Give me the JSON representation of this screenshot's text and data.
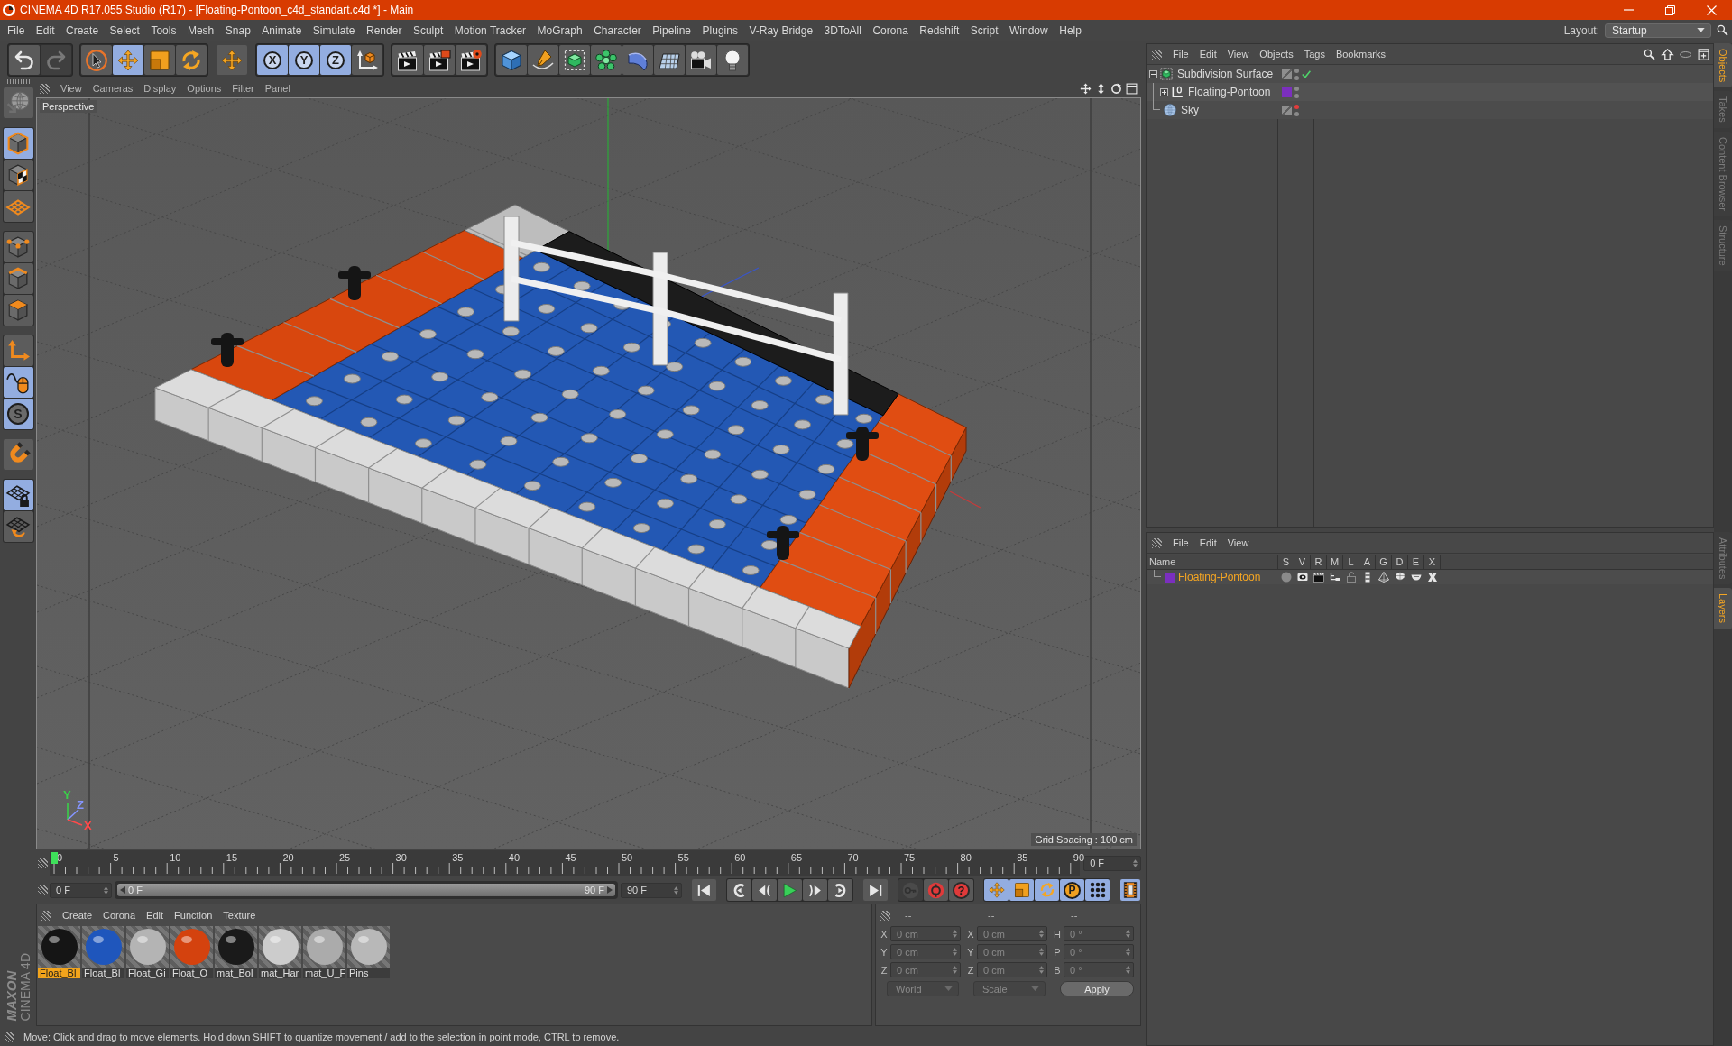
{
  "window": {
    "title": "CINEMA 4D R17.055 Studio (R17) - [Floating-Pontoon_c4d_standart.c4d *] - Main"
  },
  "menu_bar": {
    "items": [
      "File",
      "Edit",
      "Create",
      "Select",
      "Tools",
      "Mesh",
      "Snap",
      "Animate",
      "Simulate",
      "Render",
      "Sculpt",
      "Motion Tracker",
      "MoGraph",
      "Character",
      "Pipeline",
      "Plugins",
      "V-Ray Bridge",
      "3DToAll",
      "Corona",
      "Redshift",
      "Script",
      "Window",
      "Help"
    ],
    "layout_label": "Layout:",
    "layout_value": "Startup"
  },
  "toolbar": {
    "groups": [
      [
        {
          "kind": "undo",
          "active": false,
          "disabled": false
        },
        {
          "kind": "redo",
          "active": false,
          "disabled": true
        }
      ],
      [
        {
          "kind": "select",
          "active": false,
          "disabled": false
        },
        {
          "kind": "move",
          "active": true,
          "disabled": false
        },
        {
          "kind": "scale",
          "active": false,
          "disabled": false
        },
        {
          "kind": "rotate",
          "active": false,
          "disabled": false
        }
      ],
      [
        {
          "kind": "move-recent",
          "active": false,
          "disabled": false
        }
      ],
      [
        {
          "kind": "axis-lock",
          "label": "X",
          "active": true,
          "disabled": false
        },
        {
          "kind": "axis-lock",
          "label": "Y",
          "active": true,
          "disabled": false
        },
        {
          "kind": "axis-lock",
          "label": "Z",
          "active": true,
          "disabled": false
        },
        {
          "kind": "coordinate-system",
          "active": false,
          "disabled": false
        }
      ],
      [
        {
          "kind": "render-view",
          "active": false,
          "disabled": false
        },
        {
          "kind": "render-picture",
          "active": false,
          "disabled": false
        },
        {
          "kind": "render-settings",
          "active": false,
          "disabled": false
        }
      ],
      [
        {
          "kind": "cube",
          "active": false,
          "disabled": false
        },
        {
          "kind": "pen",
          "active": false,
          "disabled": false
        },
        {
          "kind": "subdivision",
          "active": false,
          "disabled": false
        },
        {
          "kind": "cloner",
          "active": false,
          "disabled": false
        },
        {
          "kind": "deformer",
          "active": false,
          "disabled": false
        },
        {
          "kind": "floor",
          "active": false,
          "disabled": false
        },
        {
          "kind": "camera",
          "active": false,
          "disabled": false
        },
        {
          "kind": "light",
          "active": false,
          "disabled": false
        }
      ]
    ]
  },
  "tool_strip": {
    "groups": [
      [
        {
          "kind": "model",
          "active": false
        }
      ],
      [
        {
          "kind": "object",
          "active": true
        },
        {
          "kind": "texture",
          "active": false
        },
        {
          "kind": "workplane",
          "active": false
        }
      ],
      [
        {
          "kind": "points",
          "active": false
        },
        {
          "kind": "edges",
          "active": false
        },
        {
          "kind": "polygons",
          "active": false
        }
      ],
      [
        {
          "kind": "axis",
          "active": false
        },
        {
          "kind": "tweak",
          "active": true
        },
        {
          "kind": "solo",
          "label": "S",
          "active": true
        }
      ],
      [
        {
          "kind": "snap",
          "active": false
        }
      ],
      [
        {
          "kind": "workplane-lock",
          "active": true
        },
        {
          "kind": "workplane-rotate",
          "active": false
        }
      ]
    ]
  },
  "viewport": {
    "menu": [
      "View",
      "Cameras",
      "Display",
      "Options",
      "Filter",
      "Panel"
    ],
    "camera": "Perspective",
    "grid_spacing": "Grid Spacing : 100 cm",
    "axes": [
      {
        "label": "Y",
        "color": "#3ad04a"
      },
      {
        "label": "Z",
        "color": "#8595ff"
      },
      {
        "label": "X",
        "color": "#ff4a4a"
      }
    ]
  },
  "timeline": {
    "ticks": [
      "0",
      "5",
      "10",
      "15",
      "20",
      "25",
      "30",
      "35",
      "40",
      "45",
      "50",
      "55",
      "60",
      "65",
      "70",
      "75",
      "80",
      "85",
      "90"
    ],
    "playhead": {
      "level": 0
    },
    "current_frame": "0 F"
  },
  "playback": {
    "start_frame": "0 F",
    "range": {
      "start": "0 F",
      "end": "90 F",
      "level": 1
    },
    "end_frame": "90 F",
    "transport": [
      [
        {
          "kind": "first"
        }
      ],
      [
        {
          "kind": "prev-key"
        },
        {
          "kind": "prev-frame"
        },
        {
          "kind": "play"
        },
        {
          "kind": "next-frame"
        },
        {
          "kind": "next-key"
        }
      ],
      [
        {
          "kind": "last"
        }
      ]
    ],
    "record": [
      {
        "kind": "record-keys",
        "disabled": true
      },
      {
        "kind": "autokey",
        "disabled": false
      },
      {
        "kind": "help",
        "label": "?",
        "disabled": false
      }
    ],
    "key_types": [
      {
        "kind": "move",
        "active": true
      },
      {
        "kind": "scale",
        "active": true
      },
      {
        "kind": "rotate",
        "active": true
      },
      {
        "kind": "param",
        "label": "P",
        "active": true
      },
      {
        "kind": "point-level",
        "active": true
      }
    ],
    "timeline_button": {
      "active": true
    }
  },
  "materials": {
    "menu": [
      "Create",
      "Corona",
      "Edit",
      "Function",
      "Texture"
    ],
    "items": [
      {
        "name": "Float_Bl",
        "color": "#151515",
        "selected": true
      },
      {
        "name": "Float_Bl",
        "color": "#1f56bc",
        "selected": false
      },
      {
        "name": "Float_Gi",
        "color": "#b4b4b4",
        "selected": false
      },
      {
        "name": "Float_O",
        "color": "#d4420e",
        "selected": false
      },
      {
        "name": "mat_Bol",
        "color": "#1a1a1a",
        "selected": false
      },
      {
        "name": "mat_Har",
        "color": "#cccccc",
        "selected": false
      },
      {
        "name": "mat_U_F",
        "color": "#ababab",
        "selected": false
      },
      {
        "name": "Pins",
        "color": "#b8b8b8",
        "selected": false
      }
    ]
  },
  "coordinates": {
    "disabled": true,
    "headers": [
      "--",
      "--",
      "--"
    ],
    "rows": [
      {
        "position_axis": "X",
        "position": "0 cm",
        "size_axis": "X",
        "size": "0 cm",
        "rotation_axis": "H",
        "rotation": "0 °"
      },
      {
        "position_axis": "Y",
        "position": "0 cm",
        "size_axis": "Y",
        "size": "0 cm",
        "rotation_axis": "P",
        "rotation": "0 °"
      },
      {
        "position_axis": "Z",
        "position": "0 cm",
        "size_axis": "Z",
        "size": "0 cm",
        "rotation_axis": "B",
        "rotation": "0 °"
      }
    ],
    "mode": "World",
    "size_mode": "Scale",
    "apply": "Apply"
  },
  "logo": {
    "brand": "MAXON",
    "product": "CINEMA 4D"
  },
  "status_bar": {
    "text": "Move: Click and drag to move elements. Hold down SHIFT to quantize movement / add to the selection in point mode, CTRL to remove."
  },
  "object_manager": {
    "menu": [
      "File",
      "Edit",
      "View",
      "Objects",
      "Tags",
      "Bookmarks"
    ],
    "objects": [
      {
        "name": "Subdivision Surface",
        "kind": "subdivision",
        "expanded": true,
        "hidden_in_editor": false,
        "enabled": true,
        "children": [
          {
            "name": "Floating-Pontoon",
            "kind": "null",
            "expanded": false,
            "color": "#7b2fbe",
            "hidden_in_editor": false,
            "enabled": false
          }
        ]
      },
      {
        "name": "Sky",
        "kind": "sky",
        "hidden_in_editor": true,
        "enabled": false
      }
    ]
  },
  "layer_manager": {
    "menu": [
      "File",
      "Edit",
      "View"
    ],
    "columns": [
      "Name",
      "S",
      "V",
      "R",
      "M",
      "L",
      "A",
      "G",
      "D",
      "E",
      "X"
    ],
    "layers": [
      {
        "name": "Floating-Pontoon",
        "color": "#7b2fbe",
        "flags": [
          {
            "kind": "solo",
            "on": false
          },
          {
            "kind": "view",
            "on": true
          },
          {
            "kind": "render",
            "on": true
          },
          {
            "kind": "manager",
            "on": true
          },
          {
            "kind": "lock",
            "on": false
          },
          {
            "kind": "animation",
            "on": true
          },
          {
            "kind": "generators",
            "on": true
          },
          {
            "kind": "deformers",
            "on": true
          },
          {
            "kind": "expressions",
            "on": true
          },
          {
            "kind": "xrefs",
            "on": true
          }
        ]
      }
    ]
  },
  "side_tabs": {
    "top": [
      {
        "label": "Objects",
        "selected": true
      },
      {
        "label": "Takes",
        "selected": false
      },
      {
        "label": "Content Browser",
        "selected": false
      },
      {
        "label": "Structure",
        "selected": false
      }
    ],
    "bottom": [
      {
        "label": "Attributes",
        "selected": false
      },
      {
        "label": "Layers",
        "selected": true
      }
    ]
  }
}
